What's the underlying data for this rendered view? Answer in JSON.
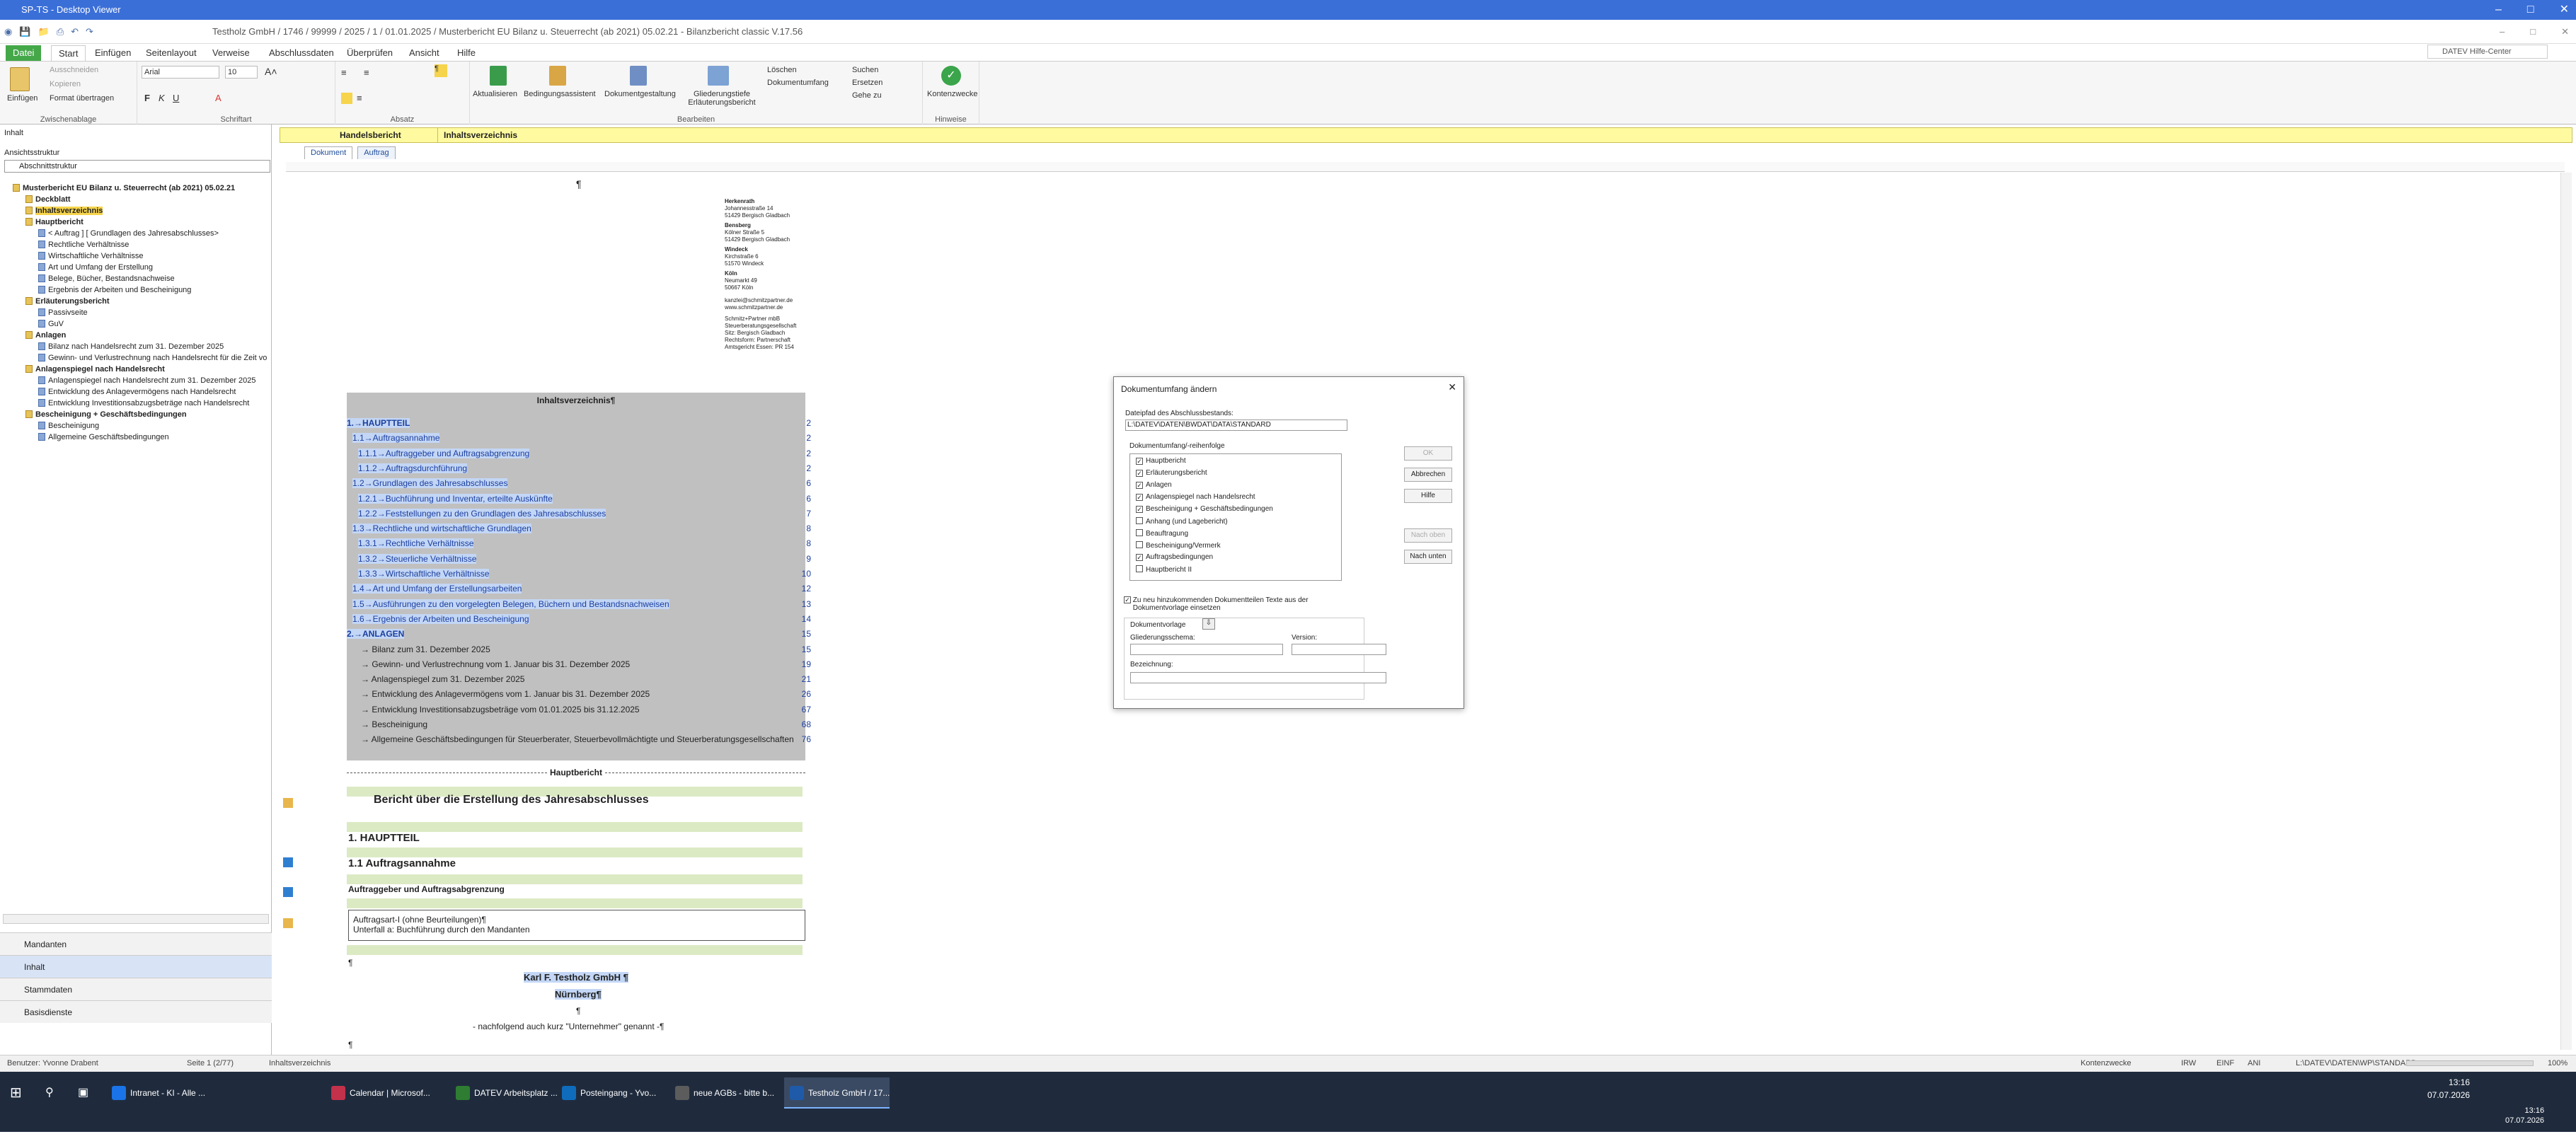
{
  "remote": {
    "title": "SP-TS - Desktop Viewer"
  },
  "app": {
    "title": "Testholz GmbH / 1746 / 99999 / 2025 / 1 / 01.01.2025 / Musterbericht EU Bilanz u. Steuerrecht (ab 2021) 05.02.21 - Bilanzbericht classic V.17.56"
  },
  "tabs": [
    "Datei",
    "Start",
    "Einfügen",
    "Seitenlayout",
    "Verweise",
    "Abschlussdaten",
    "Überprüfen",
    "Ansicht",
    "Hilfe"
  ],
  "active_tab": "Start",
  "help_search": {
    "placeholder": "DATEV Hilfe-Center"
  },
  "ribbon": {
    "clipboard": {
      "paste": "Einfügen",
      "cut": "Ausschneiden",
      "copy": "Kopieren",
      "format": "Format übertragen",
      "label": "Zwischenablage"
    },
    "font": {
      "name": "Arial",
      "size": "10",
      "label": "Schriftart"
    },
    "paragraph": {
      "label": "Absatz"
    },
    "edit": {
      "refresh": "Aktualisieren",
      "wizard": "Bedingungsassistent",
      "design": "Dokumentgestaltung",
      "structure": "Gliederungstiefe Erläuterungsbericht",
      "delete": "Löschen",
      "scope": "Dokumentumfang",
      "search": "Suchen",
      "replace": "Ersetzen",
      "goto": "Gehe zu",
      "label": "Bearbeiten"
    },
    "hints": {
      "check": "Kontenzwecke",
      "label": "Hinweise"
    }
  },
  "left": {
    "header": "Inhalt",
    "view_label": "Ansichtsstruktur",
    "view_value": "Abschnittstruktur",
    "tree": [
      {
        "t": "Musterbericht EU Bilanz u. Steuerrecht (ab 2021) 05.02.21",
        "d": 0,
        "b": true
      },
      {
        "t": "Deckblatt",
        "d": 1,
        "b": true
      },
      {
        "t": "Inhaltsverzeichnis",
        "d": 1,
        "b": true
      },
      {
        "t": "Hauptbericht",
        "d": 1,
        "b": true
      },
      {
        "t": "< Auftrag ] [ Grundlagen des Jahresabschlusses>",
        "d": 2
      },
      {
        "t": "Rechtliche Verhältnisse",
        "d": 2
      },
      {
        "t": "Wirtschaftliche Verhältnisse",
        "d": 2
      },
      {
        "t": "Art und Umfang der Erstellung",
        "d": 2
      },
      {
        "t": "Belege, Bücher, Bestandsnachweise",
        "d": 2
      },
      {
        "t": "Ergebnis der Arbeiten und Bescheinigung",
        "d": 2
      },
      {
        "t": "Erläuterungsbericht",
        "d": 1,
        "b": true
      },
      {
        "t": "Passivseite",
        "d": 2
      },
      {
        "t": "GuV",
        "d": 2
      },
      {
        "t": "Anlagen",
        "d": 1,
        "b": true
      },
      {
        "t": "Bilanz nach Handelsrecht zum 31. Dezember 2025",
        "d": 2
      },
      {
        "t": "Gewinn- und Verlustrechnung nach Handelsrecht für die Zeit vo",
        "d": 2
      },
      {
        "t": "Anlagenspiegel nach Handelsrecht",
        "d": 1,
        "b": true
      },
      {
        "t": "Anlagenspiegel nach Handelsrecht zum 31. Dezember 2025",
        "d": 2
      },
      {
        "t": "Entwicklung des Anlagevermögens nach Handelsrecht",
        "d": 2
      },
      {
        "t": "Entwicklung Investitionsabzugsbeträge nach Handelsrecht",
        "d": 2
      },
      {
        "t": "Bescheinigung + Geschäftsbedingungen",
        "d": 1,
        "b": true
      },
      {
        "t": "Bescheinigung",
        "d": 2
      },
      {
        "t": "Allgemeine Geschäftsbedingungen",
        "d": 2
      }
    ],
    "nav": [
      "Mandanten",
      "Inhalt",
      "Stammdaten",
      "Basisdienste"
    ]
  },
  "doc": {
    "band_left": "Handelsbericht",
    "band_right": "Inhaltsverzeichnis",
    "tabs": [
      "Dokument",
      "Auftrag"
    ],
    "letterhead": [
      "Herkenrath",
      "Johannesstraße 14",
      "51429 Bergisch Gladbach",
      "Bensberg",
      "Kölner Straße 5",
      "51429 Bergisch Gladbach",
      "Windeck",
      "Kirchstraße 6",
      "51570 Windeck",
      "Köln",
      "Neumarkt 49",
      "50667 Köln",
      "kanzlei@schmitzpartner.de",
      "www.schmitzpartner.de",
      "Schmitz+Partner mbB",
      "Steuerberatungsgesellschaft",
      "Sitz: Bergisch Gladbach",
      "Rechtsform: Partnerschaft",
      "Amtsgericht Essen: PR 154"
    ],
    "toc_title": "Inhaltsverzeichnis¶",
    "toc": [
      {
        "l": "1.→HAUPTTEIL",
        "p": "2",
        "i": 0
      },
      {
        "l": "1.1→Auftragsannahme",
        "p": "2",
        "i": 1
      },
      {
        "l": "1.1.1→Auftraggeber und Auftragsabgrenzung",
        "p": "2",
        "i": 2
      },
      {
        "l": "1.1.2→Auftragsdurchführung",
        "p": "2",
        "i": 2
      },
      {
        "l": "1.2→Grundlagen des Jahresabschlusses",
        "p": "6",
        "i": 1
      },
      {
        "l": "1.2.1→Buchführung und Inventar, erteilte Auskünfte",
        "p": "6",
        "i": 2
      },
      {
        "l": "1.2.2→Feststellungen zu den Grundlagen des Jahresabschlusses",
        "p": "7",
        "i": 2
      },
      {
        "l": "1.3→Rechtliche und wirtschaftliche Grundlagen",
        "p": "8",
        "i": 1
      },
      {
        "l": "1.3.1→Rechtliche Verhältnisse",
        "p": "8",
        "i": 2
      },
      {
        "l": "1.3.2→Steuerliche Verhältnisse",
        "p": "9",
        "i": 2
      },
      {
        "l": "1.3.3→Wirtschaftliche Verhältnisse",
        "p": "10",
        "i": 2
      },
      {
        "l": "1.4→Art und Umfang der Erstellungsarbeiten",
        "p": "12",
        "i": 1
      },
      {
        "l": "1.5→Ausführungen zu den vorgelegten Belegen, Büchern und Bestandsnachweisen",
        "p": "13",
        "i": 1
      },
      {
        "l": "1.6→Ergebnis der Arbeiten und Bescheinigung",
        "p": "14",
        "i": 1
      },
      {
        "l": "2.→ANLAGEN",
        "p": "15",
        "i": 0
      },
      {
        "l": "→ Bilanz zum 31. Dezember 2025",
        "p": "15",
        "i": 3
      },
      {
        "l": "→ Gewinn- und Verlustrechnung vom 1. Januar bis 31. Dezember 2025",
        "p": "19",
        "i": 3
      },
      {
        "l": "→ Anlagenspiegel zum 31. Dezember 2025",
        "p": "21",
        "i": 3
      },
      {
        "l": "→ Entwicklung des Anlagevermögens vom 1. Januar bis 31. Dezember 2025",
        "p": "26",
        "i": 3
      },
      {
        "l": "→ Entwicklung Investitionsabzugsbeträge vom 01.01.2025 bis 31.12.2025",
        "p": "67",
        "i": 3
      },
      {
        "l": "→ Bescheinigung",
        "p": "68",
        "i": 3
      },
      {
        "l": "→ Allgemeine Geschäftsbedingungen für Steuerberater, Steuerbevollmächtigte und Steuerberatungsgesellschaften",
        "p": "76",
        "i": 3
      }
    ],
    "section_mark": "Hauptbericht",
    "h_main": "Bericht über die Erstellung des Jahresabschlusses",
    "h1": "1.   HAUPTTEIL",
    "h11": "1.1   Auftragsannahme",
    "h111": "Auftraggeber und Auftragsabgrenzung",
    "box1": "Auftragsart-I (ohne Beurteilungen)¶",
    "box2": "Unterfall a: Buchführung durch den Mandanten",
    "company": "Karl F. Testholz GmbH ¶",
    "city": "Nürnberg¶",
    "pilcrow": "¶",
    "follow": "- nachfolgend auch kurz \"Unternehmer\" genannt -¶"
  },
  "dialog": {
    "title": "Dokumentumfang ändern",
    "path_label": "Dateipfad des Abschlussbestands:",
    "path_value": "L:\\DATEV\\DATEN\\BWDAT\\DATA\\STANDARD",
    "list_label": "Dokumentumfang/-reihenfolge",
    "items": [
      {
        "t": "Hauptbericht",
        "c": true
      },
      {
        "t": "Erläuterungsbericht",
        "c": true
      },
      {
        "t": "Anlagen",
        "c": true
      },
      {
        "t": "Anlagenspiegel nach Handelsrecht",
        "c": true
      },
      {
        "t": "Bescheinigung + Geschäftsbedingungen",
        "c": true
      },
      {
        "t": "Anhang (und Lagebericht)",
        "c": false
      },
      {
        "t": "Beauftragung",
        "c": false
      },
      {
        "t": "Bescheinigung/Vermerk",
        "c": false
      },
      {
        "t": "Auftragsbedingungen",
        "c": true
      },
      {
        "t": "Hauptbericht II",
        "c": false
      }
    ],
    "btn_ok": "OK",
    "btn_cancel": "Abbrechen",
    "btn_help": "Hilfe",
    "btn_up": "Nach oben",
    "btn_down": "Nach unten",
    "insert_text": "Zu neu hinzukommenden Dokumentteilen Texte aus der Dokumentvorlage einsetzen",
    "template_label": "Dokumentvorlage",
    "scheme_label": "Gliederungsschema:",
    "version_label": "Version:",
    "desc_label": "Bezeichnung:"
  },
  "status": {
    "user": "Benutzer: Yvonne Drabent",
    "page": "Seite 1 (2/77)",
    "section": "Inhaltsverzeichnis",
    "mode": "Kontenzwecke",
    "flags": [
      "IRW",
      "EINF",
      "ANI"
    ],
    "path": "L:\\DATEV\\DATEN\\WP\\STANDARD",
    "zoom": "100%"
  },
  "taskbar": {
    "apps": [
      {
        "t": "Intranet - KI - Alle ...",
        "c": "#1a73e8"
      },
      {
        "t": "Calendar | Microsof...",
        "c": "#c4314b"
      },
      {
        "t": "DATEV Arbeitsplatz ...",
        "c": "#2e7d32"
      },
      {
        "t": "Posteingang - Yvo...",
        "c": "#0f6cbd"
      },
      {
        "t": "neue AGBs - bitte b...",
        "c": "#5c5c5c"
      },
      {
        "t": "Testholz GmbH / 17...",
        "c": "#1f5aa8"
      }
    ],
    "time1": "13:16",
    "date1": "07.07.2026",
    "time2": "13:16",
    "date2": "07.07.2026"
  }
}
